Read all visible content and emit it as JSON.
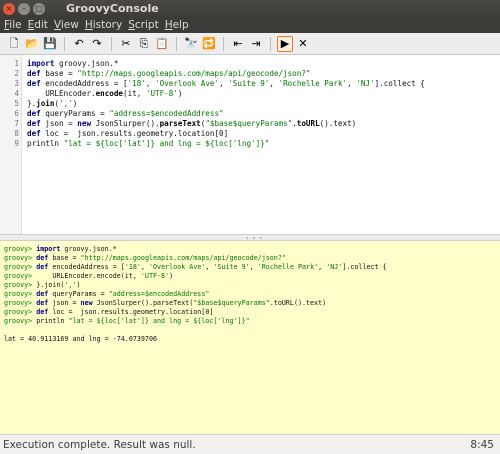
{
  "window": {
    "title": "GroovyConsole",
    "buttons": {
      "close": "×",
      "minimize": "–",
      "maximize": "□"
    }
  },
  "menu": [
    {
      "label": "File"
    },
    {
      "label": "Edit"
    },
    {
      "label": "View"
    },
    {
      "label": "History"
    },
    {
      "label": "Script"
    },
    {
      "label": "Help"
    }
  ],
  "toolbar": {
    "icons": [
      {
        "name": "new-file-icon",
        "glyph": "🗋"
      },
      {
        "name": "open-folder-icon",
        "glyph": "📂"
      },
      {
        "name": "save-icon",
        "glyph": "💾"
      },
      {
        "name": "undo-icon",
        "glyph": "↶"
      },
      {
        "name": "redo-icon",
        "glyph": "↷"
      },
      {
        "name": "cut-icon",
        "glyph": "✂"
      },
      {
        "name": "copy-icon",
        "glyph": "⎘"
      },
      {
        "name": "paste-icon",
        "glyph": "📋"
      },
      {
        "name": "find-icon",
        "glyph": "🔭"
      },
      {
        "name": "replace-icon",
        "glyph": "🔁"
      },
      {
        "name": "previous-history-icon",
        "glyph": "⇤"
      },
      {
        "name": "next-history-icon",
        "glyph": "⇥"
      },
      {
        "name": "run-script-icon",
        "glyph": "▶"
      },
      {
        "name": "interrupt-script-icon",
        "glyph": "✕"
      }
    ],
    "colors": {
      "active_border": "#e87b2a"
    }
  },
  "editor": {
    "lines": [
      {
        "num": "1",
        "parts": [
          [
            "kw",
            "import"
          ],
          [
            "",
            " groovy.json.*"
          ]
        ]
      },
      {
        "num": "2",
        "parts": [
          [
            "kw",
            "def"
          ],
          [
            "",
            " base = "
          ],
          [
            "str",
            "\"http://maps.googleapis.com/maps/api/geocode/json?\""
          ]
        ]
      },
      {
        "num": "3",
        "parts": [
          [
            "kw",
            "def"
          ],
          [
            "",
            " encodedAddress = ["
          ],
          [
            "str",
            "'18'"
          ],
          [
            "",
            ", "
          ],
          [
            "str",
            "'Overlook Ave'"
          ],
          [
            "",
            ", "
          ],
          [
            "str",
            "'Suite 9'"
          ],
          [
            "",
            ", "
          ],
          [
            "str",
            "'Rochelle Park'"
          ],
          [
            "",
            ", "
          ],
          [
            "str",
            "'NJ'"
          ],
          [
            "",
            "].collect {"
          ]
        ]
      },
      {
        "num": "4",
        "parts": [
          [
            "",
            "    URLEncoder."
          ],
          [
            "meth",
            "encode"
          ],
          [
            "",
            "(it, "
          ],
          [
            "str",
            "'UTF-8'"
          ],
          [
            "",
            ")"
          ]
        ]
      },
      {
        "num": "5",
        "parts": [
          [
            "",
            "}."
          ],
          [
            "meth",
            "join"
          ],
          [
            "",
            "("
          ],
          [
            "str",
            "','"
          ],
          [
            "",
            ")"
          ]
        ]
      },
      {
        "num": "6",
        "parts": [
          [
            "kw",
            "def"
          ],
          [
            "",
            " queryParams = "
          ],
          [
            "str",
            "\"address=$encodedAddress\""
          ]
        ]
      },
      {
        "num": "7",
        "parts": [
          [
            "kw",
            "def"
          ],
          [
            "",
            " json = "
          ],
          [
            "kw",
            "new"
          ],
          [
            "",
            " JsonSlurper()."
          ],
          [
            "meth",
            "parseText"
          ],
          [
            "",
            "("
          ],
          [
            "str",
            "\"$base$queryParams\""
          ],
          [
            "",
            "."
          ],
          [
            "meth",
            "toURL"
          ],
          [
            "",
            "().text)"
          ]
        ]
      },
      {
        "num": "8",
        "parts": [
          [
            "kw",
            "def"
          ],
          [
            "",
            " loc =  json.results.geometry.location[0]"
          ]
        ]
      },
      {
        "num": "9",
        "parts": [
          [
            "",
            "println "
          ],
          [
            "str",
            "\"lat = ${loc['lat']} and lng = ${loc['lng']}\""
          ]
        ]
      }
    ]
  },
  "output": {
    "lines": [
      {
        "parts": [
          [
            "prompt",
            "groovy> "
          ],
          [
            "okw",
            "import"
          ],
          [
            "",
            " groovy.json.*"
          ]
        ]
      },
      {
        "parts": [
          [
            "prompt",
            "groovy> "
          ],
          [
            "okw",
            "def"
          ],
          [
            "",
            " base = "
          ],
          [
            "ostr",
            "\"http://maps.googleapis.com/maps/api/geocode/json?\""
          ]
        ]
      },
      {
        "parts": [
          [
            "prompt",
            "groovy> "
          ],
          [
            "okw",
            "def"
          ],
          [
            "",
            " encodedAddress = ["
          ],
          [
            "ostr",
            "'18'"
          ],
          [
            "",
            ", "
          ],
          [
            "ostr",
            "'Overlook Ave'"
          ],
          [
            "",
            ", "
          ],
          [
            "ostr",
            "'Suite 9'"
          ],
          [
            "",
            ", "
          ],
          [
            "ostr",
            "'Rochelle Park'"
          ],
          [
            "",
            ", "
          ],
          [
            "ostr",
            "'NJ'"
          ],
          [
            "",
            "].collect {"
          ]
        ]
      },
      {
        "parts": [
          [
            "prompt",
            "groovy> "
          ],
          [
            "",
            "    URLEncoder.encode(it, "
          ],
          [
            "ostr",
            "'UTF-8'"
          ],
          [
            "",
            ")"
          ]
        ]
      },
      {
        "parts": [
          [
            "prompt",
            "groovy> "
          ],
          [
            "",
            "}.join("
          ],
          [
            "ostr",
            "','"
          ],
          [
            "",
            ")"
          ]
        ]
      },
      {
        "parts": [
          [
            "prompt",
            "groovy> "
          ],
          [
            "okw",
            "def"
          ],
          [
            "",
            " queryParams = "
          ],
          [
            "ostr",
            "\"address=$encodedAddress\""
          ]
        ]
      },
      {
        "parts": [
          [
            "prompt",
            "groovy> "
          ],
          [
            "okw",
            "def"
          ],
          [
            "",
            " json = "
          ],
          [
            "okw",
            "new"
          ],
          [
            "",
            " JsonSlurper().parseText("
          ],
          [
            "ostr",
            "\"$base$queryParams\""
          ],
          [
            "",
            ".toURL().text)"
          ]
        ]
      },
      {
        "parts": [
          [
            "prompt",
            "groovy> "
          ],
          [
            "okw",
            "def"
          ],
          [
            "",
            " loc =  json.results.geometry.location[0]"
          ]
        ]
      },
      {
        "parts": [
          [
            "prompt",
            "groovy> "
          ],
          [
            "",
            "println "
          ],
          [
            "ostr",
            "\"lat = ${loc['lat']} and lng = ${loc['lng']}\""
          ]
        ]
      },
      {
        "parts": [
          [
            "",
            ""
          ]
        ]
      },
      {
        "parts": [
          [
            "",
            "lat = 40.9113169 and lng = -74.0739706"
          ]
        ]
      }
    ],
    "colors": {
      "background": "#ffffcc",
      "prompt": "#008000"
    }
  },
  "status": {
    "message": "Execution complete. Result was null.",
    "position": "8:45"
  }
}
